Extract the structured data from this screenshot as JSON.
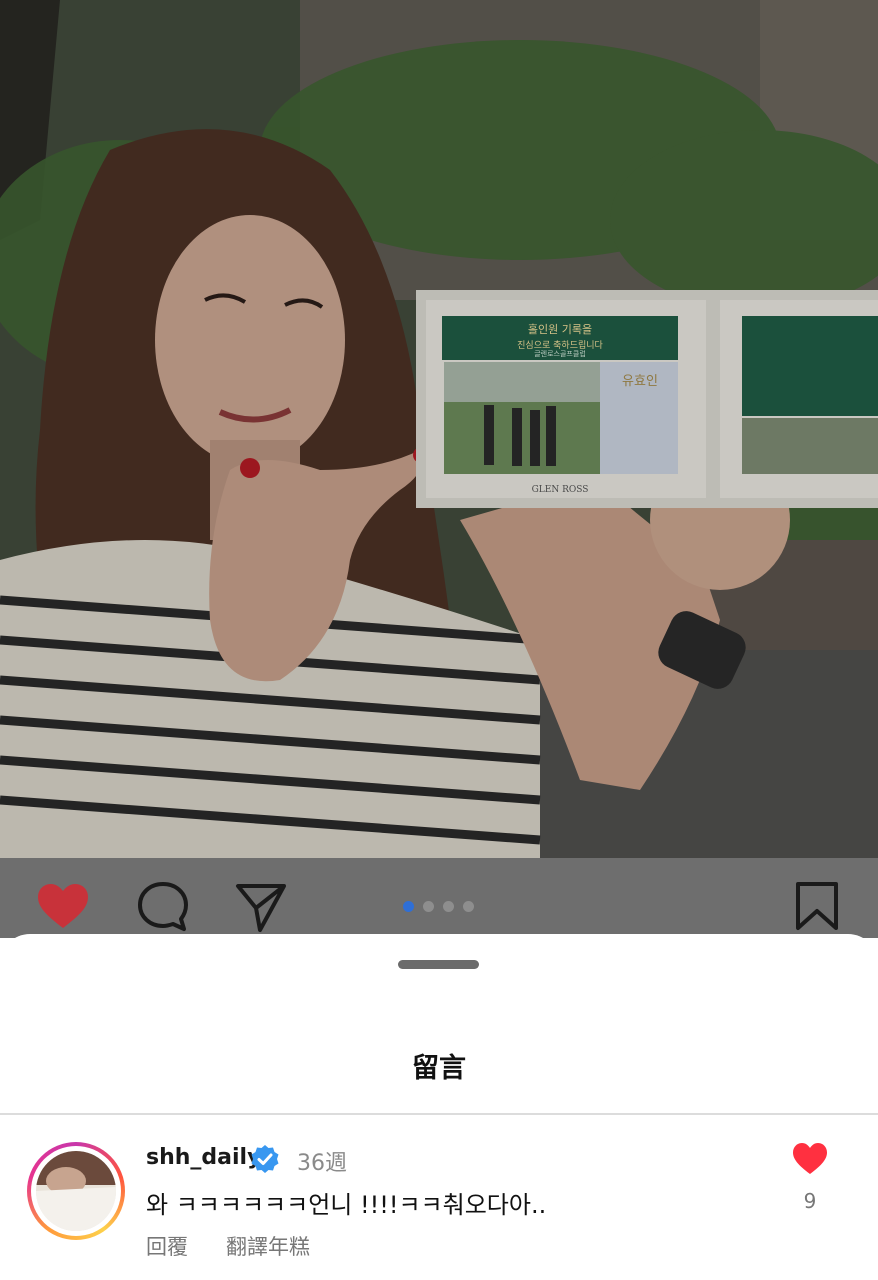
{
  "photo": {
    "scorecard_header": "홀인원 기록을",
    "scorecard_subheader": "진심으로 축하드립니다",
    "club_name": "글렌로스골프클럽",
    "brand": "GLEN ROSS",
    "player_name": "유효인"
  },
  "actions": {
    "carousel_pages": 4,
    "carousel_active_index": 0,
    "liked": true
  },
  "sheet": {
    "title": "留言"
  },
  "comments": [
    {
      "username": "shh_daily",
      "verified": true,
      "time": "36週",
      "text": "와 ㅋㅋㅋㅋㅋㅋ언니 !!!!ㅋㅋ춰오다아..",
      "reply_label": "回覆",
      "translate_label": "翻譯年糕",
      "like_count": "9",
      "liked": true
    }
  ],
  "colors": {
    "like_red": "#ff3040",
    "verified_blue": "#3897f0",
    "dot_active": "#2f6fd6"
  }
}
